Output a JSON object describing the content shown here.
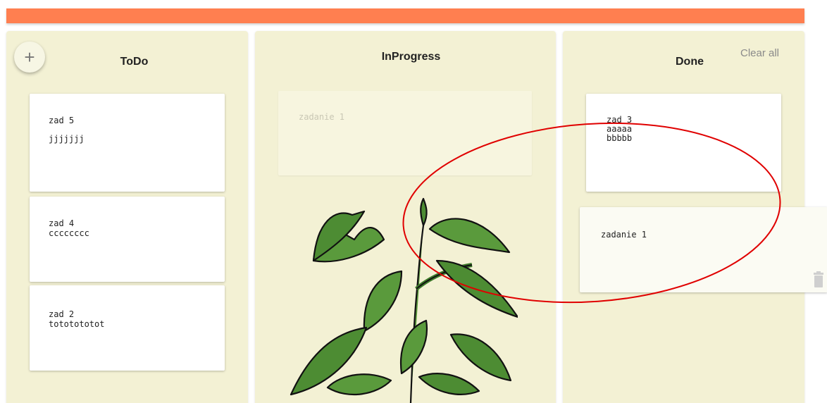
{
  "board": {
    "columns": [
      {
        "title": "ToDo",
        "cards": [
          {
            "title": "zad 5",
            "body": "jjjjjjj"
          },
          {
            "title": "zad 4",
            "body": "cccccccc"
          },
          {
            "title": "zad 2",
            "body": "tototototot"
          }
        ]
      },
      {
        "title": "InProgress",
        "cards": [
          {
            "title": "zadanie 1",
            "body": ""
          }
        ]
      },
      {
        "title": "Done",
        "cards": [
          {
            "title": "zad 3",
            "body": "aaaaa\nbbbbb"
          },
          {
            "title": "zadanie 1",
            "body": ""
          }
        ]
      }
    ]
  },
  "actions": {
    "add_label": "+",
    "clear_all_label": "Clear all"
  },
  "icons": {
    "add": "plus-icon",
    "delete": "trash-icon",
    "decoration": "plant-illustration"
  },
  "colors": {
    "header_bar": "#ff7f50",
    "column_bg": "#f3f1d4",
    "card_bg": "#ffffff",
    "annotation": "#e00000",
    "leaf": "#5a9a3c"
  }
}
